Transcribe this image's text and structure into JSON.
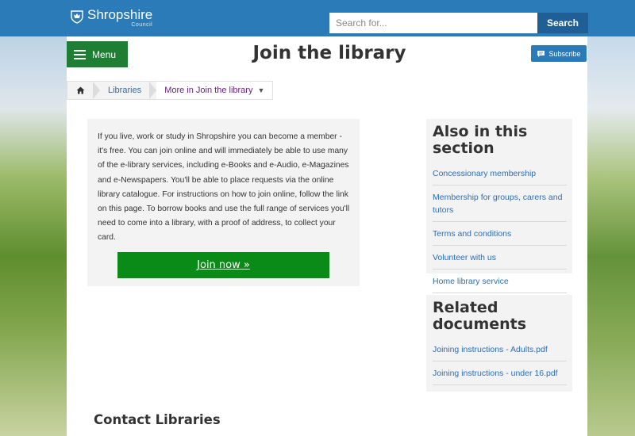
{
  "header": {
    "logo_name": "Shropshire",
    "logo_sub": "Council",
    "search_placeholder": "Search for...",
    "search_button": "Search"
  },
  "nav": {
    "menu_label": "Menu",
    "subscribe_label": "Subscribe"
  },
  "page": {
    "title": "Join the library"
  },
  "breadcrumb": {
    "items": [
      "Libraries",
      "More in Join the library"
    ]
  },
  "intro": {
    "text": "If you live, work or study in Shropshire you can become a member - it's free. You can join online and will immediately be able to use many of the e-library services, including e-Books and e-Audio, e-Magazines and e-Newspapers. You'll be able to place requests via the online library catalogue. For instructions on how to join online, follow the link on this page. To borrow books and use the full range of services you'll need to come into a library, with a proof of address, to collect your card.",
    "join_button": "Join now »"
  },
  "also_in_section": {
    "heading": "Also in this section",
    "links": [
      "Concessionary membership",
      "Membership for groups, carers and tutors",
      "Terms and conditions",
      "Volunteer with us",
      "Home library service"
    ]
  },
  "related_documents": {
    "heading": "Related documents",
    "links": [
      "Joining instructions - Adults.pdf",
      "Joining instructions - under 16.pdf"
    ]
  },
  "contact": {
    "heading": "Contact Libraries"
  },
  "colors": {
    "header_bg": "#2a7bb8",
    "menu_green": "#1e7e34",
    "join_green": "#0a8a16",
    "link_blue": "#2a6ebb",
    "breadcrumb_purple": "#6b1f8a"
  },
  "icons": [
    "crest-icon",
    "hamburger-icon",
    "subscribe-icon",
    "home-icon",
    "caret-down-icon"
  ]
}
